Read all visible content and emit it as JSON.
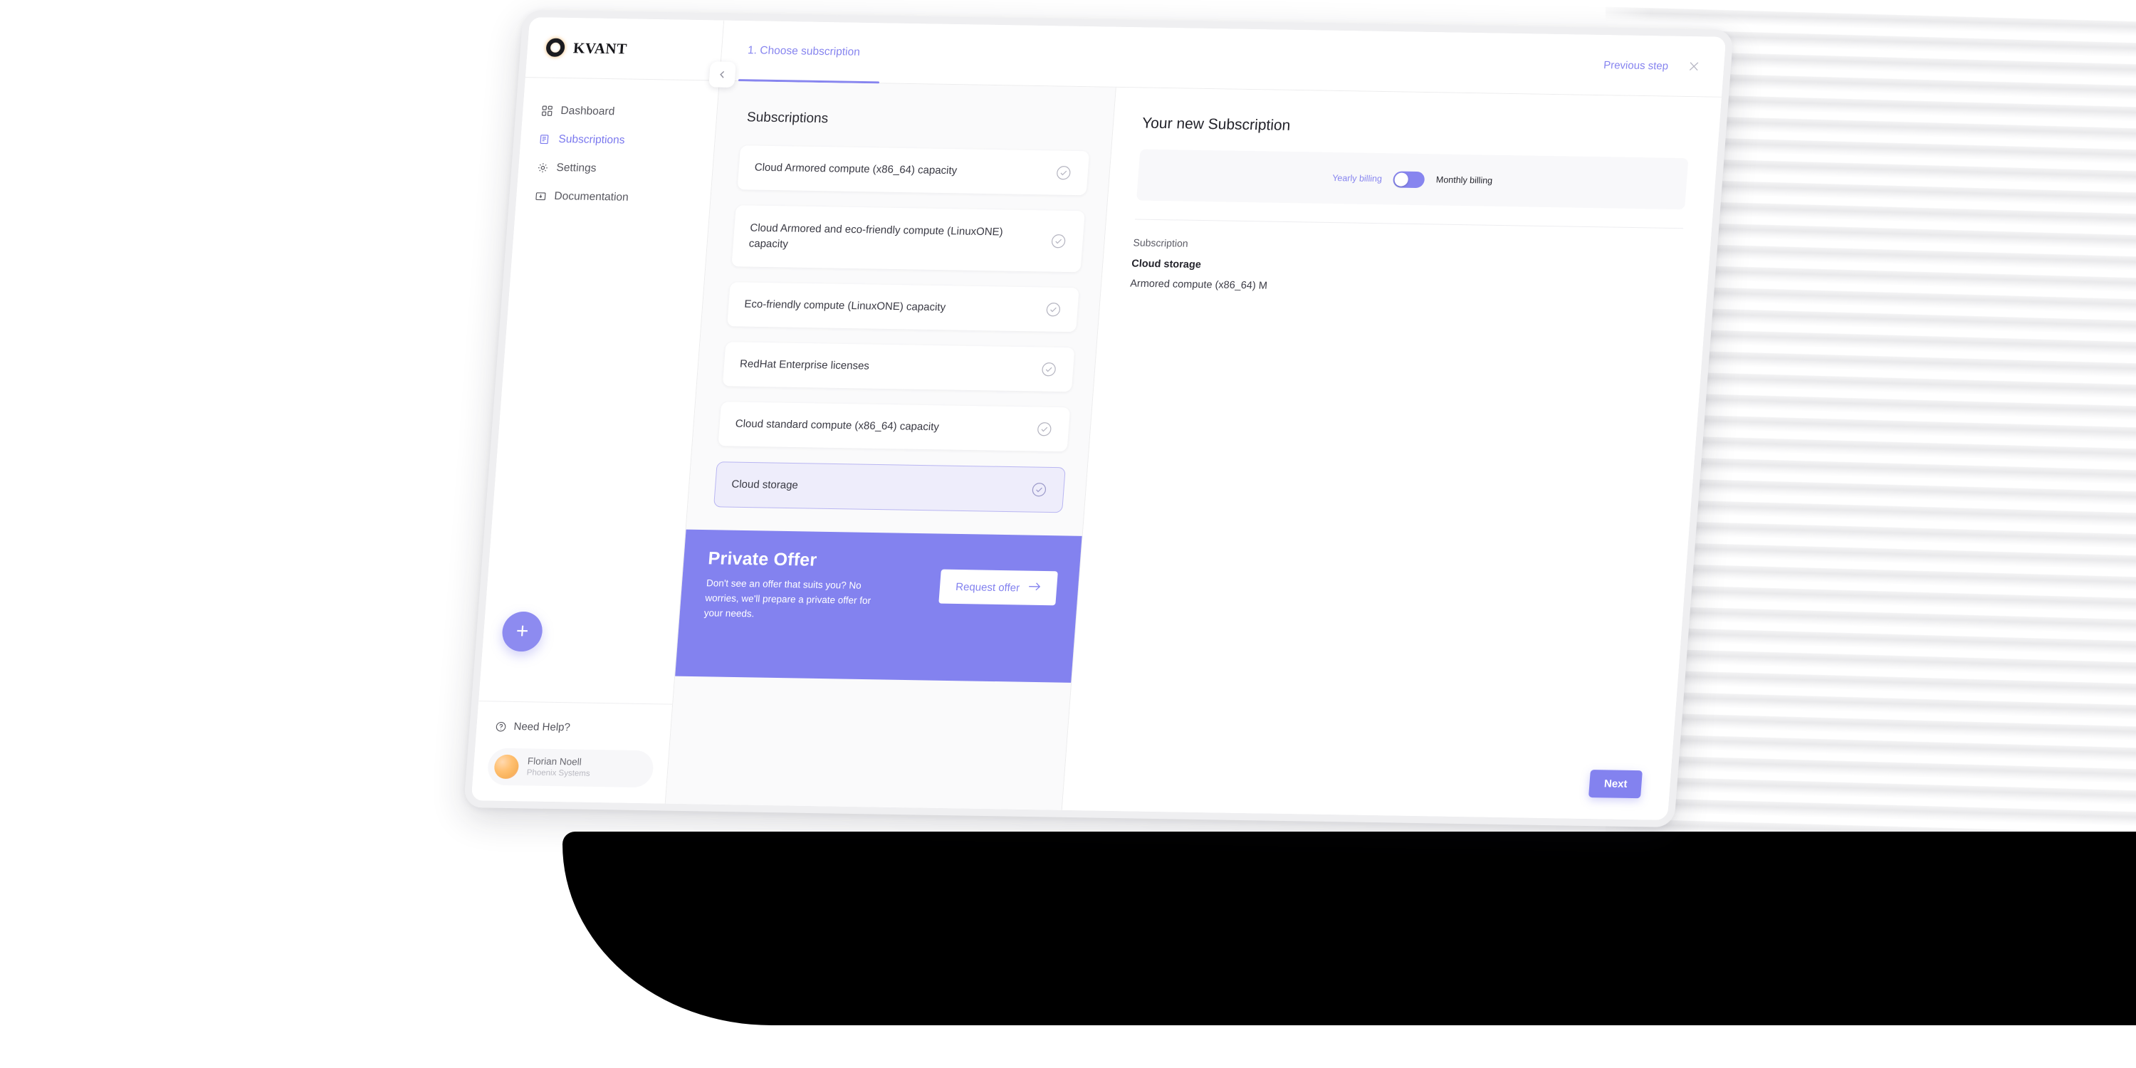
{
  "brand": {
    "name": "KVANT",
    "logo_icon": "ring-logo-icon"
  },
  "sidebar": {
    "items": [
      {
        "label": "Dashboard",
        "icon": "dashboard-icon",
        "active": false
      },
      {
        "label": "Subscriptions",
        "icon": "subscriptions-icon",
        "active": true
      },
      {
        "label": "Settings",
        "icon": "gear-icon",
        "active": false
      },
      {
        "label": "Documentation",
        "icon": "document-icon",
        "active": false
      }
    ],
    "add_button_label": "+",
    "need_help_label": "Need Help?",
    "need_help_icon": "question-circle-icon",
    "user": {
      "name": "Florian Noell",
      "org": "Phoenix Systems",
      "avatar": "user-avatar"
    }
  },
  "topbar": {
    "step_label": "1. Choose subscription",
    "previous_step_label": "Previous step",
    "close_icon": "close-icon",
    "collapse_icon": "chevron-left-icon"
  },
  "list_panel": {
    "title": "Subscriptions",
    "items": [
      {
        "label": "Cloud Armored compute (x86_64) capacity",
        "selected": false,
        "icon": "check-circle-icon"
      },
      {
        "label": "Cloud Armored and eco-friendly compute (LinuxONE) capacity",
        "selected": false,
        "icon": "check-circle-icon"
      },
      {
        "label": "Eco-friendly compute (LinuxONE) capacity",
        "selected": false,
        "icon": "check-circle-icon"
      },
      {
        "label": "RedHat Enterprise licenses",
        "selected": false,
        "icon": "check-circle-icon"
      },
      {
        "label": "Cloud standard compute (x86_64) capacity",
        "selected": false,
        "icon": "check-circle-icon"
      },
      {
        "label": "Cloud storage",
        "selected": true,
        "icon": "check-circle-icon"
      }
    ],
    "offer": {
      "title": "Private Offer",
      "text": "Don't see an offer that suits you? No worries, we'll prepare a private offer for your needs.",
      "button_label": "Request offer",
      "button_icon": "arrow-right-icon"
    }
  },
  "summary_panel": {
    "title": "Your new Subscription",
    "billing": {
      "yearly_label": "Yearly billing",
      "monthly_label": "Monthly billing",
      "toggle_state": "yearly"
    },
    "subscription_key": "Subscription",
    "subscription_name": "Cloud storage",
    "subscription_detail": "Armored compute (x86_64) M",
    "next_label": "Next"
  },
  "colors": {
    "accent": "#8382ef",
    "accent_light": "#eeedfb",
    "accent_border": "#b9b6f2",
    "text_dark": "#24242c",
    "text_muted": "#5c5c66",
    "panel_bg": "#fafafb"
  }
}
